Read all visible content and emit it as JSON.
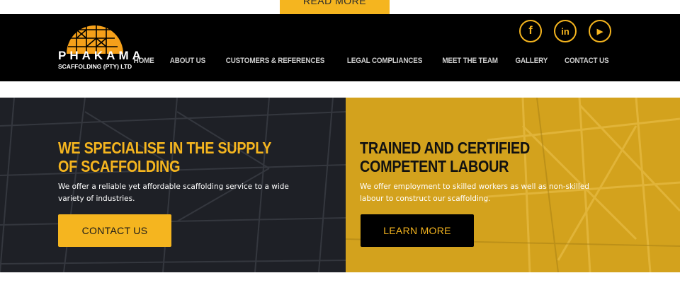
{
  "top": {
    "read_more_label": "READ MORE"
  },
  "brand": {
    "name": "PHAKAMA",
    "subtitle": "SCAFFOLDING (PTY) LTD"
  },
  "social": [
    {
      "icon": "facebook-icon",
      "glyph": "f"
    },
    {
      "icon": "linkedin-icon",
      "glyph": "in"
    },
    {
      "icon": "youtube-icon",
      "glyph": "▶"
    }
  ],
  "nav": {
    "items": [
      "HOME",
      "ABOUT US",
      "CUSTOMERS & REFERENCES",
      "LEGAL COMPLIANCES",
      "MEET THE TEAM",
      "GALLERY",
      "CONTACT US"
    ]
  },
  "hero": {
    "left": {
      "title": "WE SPECIALISE IN THE SUPPLY OF SCAFFOLDING",
      "text": "We offer a reliable yet affordable scaffolding service to a wide variety of industries.",
      "button": "CONTACT US"
    },
    "right": {
      "title": "TRAINED AND CERTIFIED COMPETENT LABOUR",
      "text": "We offer employment to skilled workers as well as non-skilled labour to construct our scaffolding.",
      "button": "LEARN MORE"
    }
  },
  "colors": {
    "accent": "#f5b51f",
    "header_bg": "#000000",
    "left_panel": "#1e2026",
    "right_panel": "#d3a21d"
  }
}
